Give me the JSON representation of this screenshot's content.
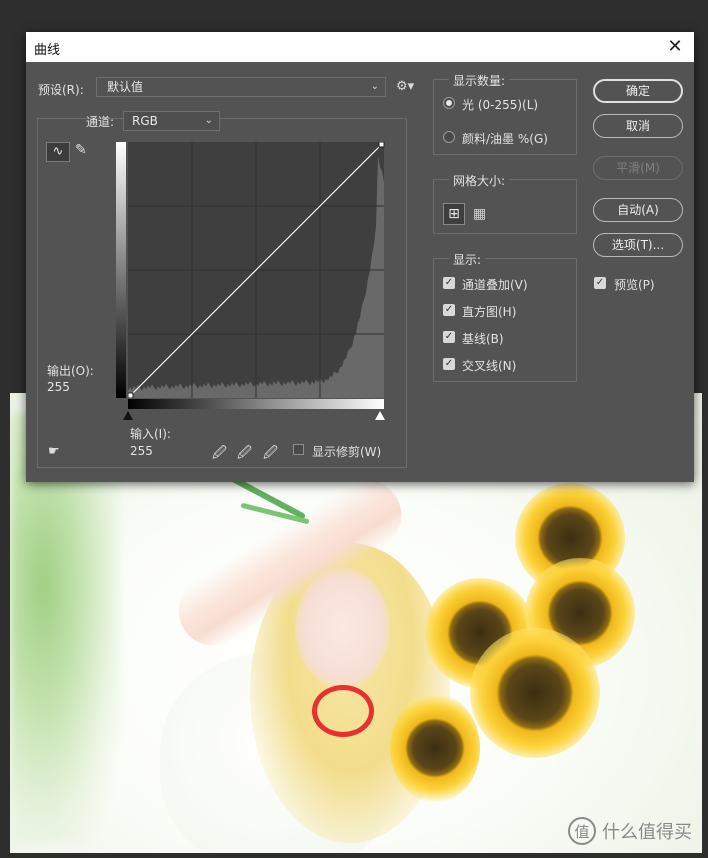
{
  "dialog": {
    "title": "曲线",
    "close_label": "✕"
  },
  "preset": {
    "label": "预设(R):",
    "value": "默认值",
    "gear_icon": "gear-icon"
  },
  "channel": {
    "label": "通道:",
    "value": "RGB"
  },
  "curve": {
    "output_label": "输出(O):",
    "output_value": "255",
    "input_label": "输入(I):",
    "input_value": "255",
    "show_clipping_label": "显示修剪(W)",
    "show_clipping_checked": false,
    "tools": {
      "curve_tool": "∿",
      "pencil_tool": "✎",
      "hand_tool": "☛"
    },
    "eyedroppers": [
      "black-eyedropper-icon",
      "gray-eyedropper-icon",
      "white-eyedropper-icon"
    ],
    "grid_divisions": 4
  },
  "display_amount": {
    "title": "显示数量:",
    "options": [
      {
        "label": "光 (0-255)(L)",
        "selected": true
      },
      {
        "label": "颜料/油墨 %(G)",
        "selected": false
      }
    ]
  },
  "grid_size": {
    "title": "网格大小:"
  },
  "show": {
    "title": "显示:",
    "options": [
      {
        "label": "通道叠加(V)",
        "checked": true
      },
      {
        "label": "直方图(H)",
        "checked": true
      },
      {
        "label": "基线(B)",
        "checked": true
      },
      {
        "label": "交叉线(N)",
        "checked": true
      }
    ]
  },
  "buttons": {
    "ok": "确定",
    "cancel": "取消",
    "smooth": "平滑(M)",
    "auto": "自动(A)",
    "options": "选项(T)..."
  },
  "preview": {
    "label": "预览(P)",
    "checked": true
  },
  "watermark": {
    "logo": "值",
    "text": "什么值得买"
  },
  "colors": {
    "dialog_bg": "#535353",
    "graph_bg": "#3f3f3f",
    "histogram": "#696969",
    "highlight_circle": "#e8302f"
  }
}
